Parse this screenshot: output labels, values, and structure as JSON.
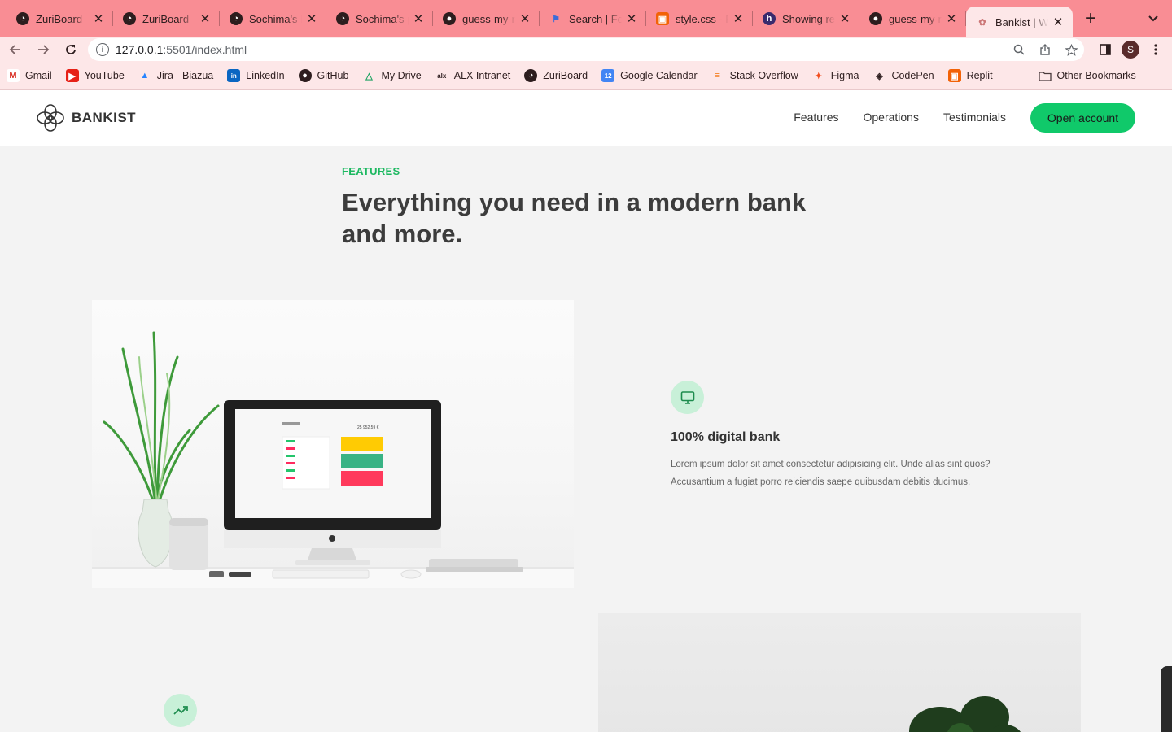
{
  "browser": {
    "tabs": [
      {
        "title": "ZuriBoard",
        "icon": "zuri-icon"
      },
      {
        "title": "ZuriBoard",
        "icon": "zuri-icon"
      },
      {
        "title": "Sochima's P",
        "icon": "zuri-icon"
      },
      {
        "title": "Sochima's p",
        "icon": "zuri-icon"
      },
      {
        "title": "guess-my-n",
        "icon": "github-icon"
      },
      {
        "title": "Search | For",
        "icon": "flag-icon"
      },
      {
        "title": "style.css - R",
        "icon": "replit-icon"
      },
      {
        "title": "Showing res",
        "icon": "hub-icon"
      },
      {
        "title": "guess-my-n",
        "icon": "github-icon"
      },
      {
        "title": "Bankist | W",
        "icon": "bankist-icon",
        "active": true
      }
    ],
    "url_host": "127.0.0.1",
    "url_path": ":5501/index.html",
    "profile_initial": "S",
    "bookmarks": [
      {
        "label": "Gmail",
        "icon": "gmail-icon"
      },
      {
        "label": "YouTube",
        "icon": "youtube-icon"
      },
      {
        "label": "Jira - Biazua",
        "icon": "jira-icon"
      },
      {
        "label": "LinkedIn",
        "icon": "linkedin-icon"
      },
      {
        "label": "GitHub",
        "icon": "github-icon"
      },
      {
        "label": "My Drive",
        "icon": "drive-icon"
      },
      {
        "label": "ALX Intranet",
        "icon": "alx-icon"
      },
      {
        "label": "ZuriBoard",
        "icon": "zuri-icon"
      },
      {
        "label": "Google Calendar",
        "icon": "calendar-icon"
      },
      {
        "label": "Stack Overflow",
        "icon": "stackoverflow-icon"
      },
      {
        "label": "Figma",
        "icon": "figma-icon"
      },
      {
        "label": "CodePen",
        "icon": "codepen-icon"
      },
      {
        "label": "Replit",
        "icon": "replit-icon"
      }
    ],
    "other_bookmarks": "Other Bookmarks"
  },
  "site": {
    "brand": "BANKIST",
    "nav": [
      "Features",
      "Operations",
      "Testimonials"
    ],
    "cta": "Open account",
    "accent_color": "#10c96a"
  },
  "features": {
    "label": "FEATURES",
    "title": "Everything you need in a modern bank and more.",
    "items": [
      {
        "title": "100% digital bank",
        "text": "Lorem ipsum dolor sit amet consectetur adipisicing elit. Unde alias sint quos? Accusantium a fugiat porro reiciendis saepe quibusdam debitis ducimus.",
        "icon": "monitor-icon"
      },
      {
        "icon": "trending-up-icon"
      }
    ],
    "mock_screen": {
      "balance": "25 952,59 €"
    }
  }
}
